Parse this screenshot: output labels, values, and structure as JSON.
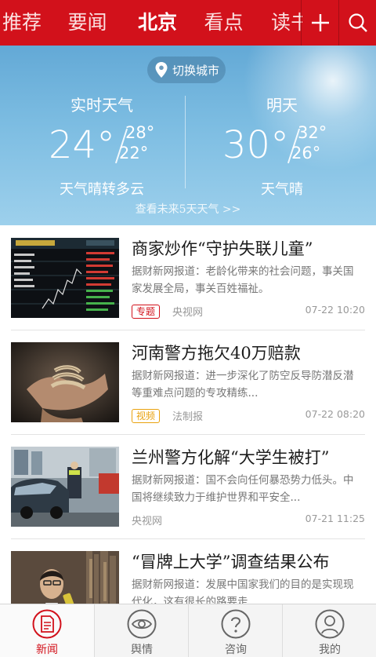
{
  "top_tabs": [
    "推荐",
    "要闻",
    "北京",
    "看点",
    "读书"
  ],
  "active_tab": "北京",
  "colors": {
    "brand_red": "#d2111b",
    "video_tag": "#e9a20e",
    "sky_blue": "#7dbde2"
  },
  "weather": {
    "switch_city": "切换城市",
    "now": {
      "title": "实时天气",
      "temp": "24°",
      "high": "28°",
      "low": "22°",
      "desc": "天气晴转多云"
    },
    "tomorrow": {
      "title": "明天",
      "temp": "30°",
      "high": "32°",
      "low": "26°",
      "desc": "天气晴"
    },
    "forecast_link": "查看未来5天天气 >>"
  },
  "news": [
    {
      "title": "商家炒作“守护失联儿童”",
      "summary": "据财新网报道：老龄化带来的社会问题，事关国家发展全局，事关百姓福祉。",
      "tag": "专题",
      "tag_color": "red",
      "source": "央视网",
      "time": "07-22 10:20",
      "image": "stock-ticker-screen"
    },
    {
      "title": "河南警方拖欠40万赔款",
      "summary": "据财新网报道：进一步深化了防空反导防潜反潜等重难点问题的专攻精练...",
      "tag": "视频",
      "tag_color": "yellow",
      "source": "法制报",
      "time": "07-22 08:20",
      "image": "roped-hands"
    },
    {
      "title": "兰州警方化解“大学生被打”",
      "summary": "据财新网报道：国不会向任何暴恐势力低头。中国将继续致力于维护世界和平安全...",
      "tag": "",
      "tag_color": "",
      "source": "央视网",
      "time": "07-21 11:25",
      "image": "street-police"
    },
    {
      "title": "“冒牌上大学”调查结果公布",
      "summary": "据财新网报道：发展中国家我们的目的是实现现代化，这有很长的路要走",
      "tag": "",
      "tag_color": "",
      "source": "",
      "time": "",
      "image": "speaker-at-microphone"
    }
  ],
  "bottom_nav": [
    {
      "label": "新闻",
      "icon": "document-icon"
    },
    {
      "label": "舆情",
      "icon": "eye-icon"
    },
    {
      "label": "咨询",
      "icon": "question-icon"
    },
    {
      "label": "我的",
      "icon": "user-icon"
    }
  ],
  "active_nav": "新闻"
}
